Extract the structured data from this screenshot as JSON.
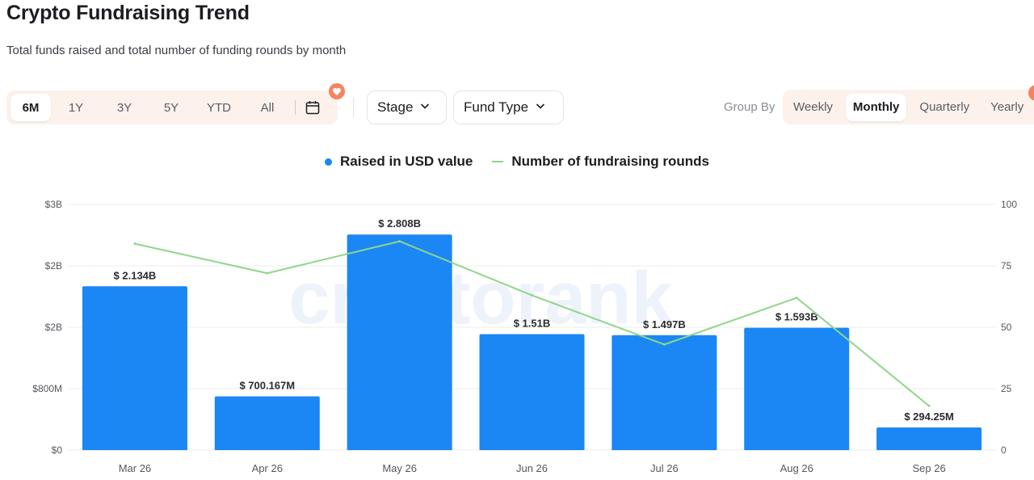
{
  "header": {
    "title": "Crypto Fundraising Trend",
    "subtitle": "Total funds raised and total number of funding rounds by month"
  },
  "range_tabs": [
    {
      "label": "6M",
      "active": true
    },
    {
      "label": "1Y",
      "active": false
    },
    {
      "label": "3Y",
      "active": false
    },
    {
      "label": "5Y",
      "active": false
    },
    {
      "label": "YTD",
      "active": false
    },
    {
      "label": "All",
      "active": false
    }
  ],
  "filters": {
    "stage_label": "Stage",
    "fund_type_label": "Fund Type"
  },
  "group_by": {
    "label": "Group By",
    "options": [
      {
        "label": "Weekly",
        "active": false
      },
      {
        "label": "Monthly",
        "active": true
      },
      {
        "label": "Quarterly",
        "active": false
      },
      {
        "label": "Yearly",
        "active": false
      }
    ]
  },
  "colors": {
    "bar": "#1a87f4",
    "line": "#8fd68a",
    "accent_badge": "#f4845f"
  },
  "watermark": "cryptorank",
  "chart_data": {
    "type": "bar",
    "categories": [
      "Mar 26",
      "Apr 26",
      "May 26",
      "Jun 26",
      "Jul 26",
      "Aug 26",
      "Sep 26"
    ],
    "series": [
      {
        "name": "Raised in USD value",
        "type": "bar",
        "axis": "left",
        "values": [
          2134000000,
          700167000,
          2808000000,
          1510000000,
          1497000000,
          1593000000,
          294250000
        ],
        "labels": [
          "$ 2.134B",
          "$ 700.167M",
          "$ 2.808B",
          "$ 1.51B",
          "$ 1.497B",
          "$ 1.593B",
          "$ 294.25M"
        ]
      },
      {
        "name": "Number of fundraising rounds",
        "type": "line",
        "axis": "right",
        "values": [
          84,
          72,
          85,
          63,
          43,
          62,
          18
        ]
      }
    ],
    "y_left": {
      "ticks": [
        0,
        800000000,
        1600000000,
        2400000000,
        3200000000
      ],
      "tick_labels": [
        "$0",
        "$800M",
        "$2B",
        "$2B",
        "$3B"
      ],
      "ylim": [
        0,
        3200000000
      ]
    },
    "y_right": {
      "ticks": [
        0,
        25,
        50,
        75,
        100
      ],
      "tick_labels": [
        "0",
        "25",
        "50",
        "75",
        "100"
      ],
      "ylim": [
        0,
        100
      ]
    },
    "grid": true,
    "legend_position": "top-center"
  }
}
